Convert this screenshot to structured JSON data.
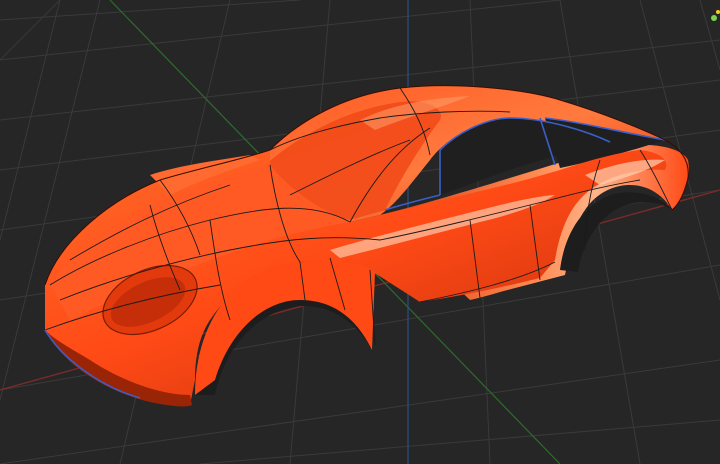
{
  "viewport": {
    "background_color": "#262626",
    "grid_color": "#3a3a3a",
    "axis_x_color": "#7a2a2a",
    "axis_y_color": "#2f6b2f",
    "axis_z_color": "#2b4f86"
  },
  "model": {
    "body_color": "#ff4a16",
    "highlight_color": "#ffb48a",
    "shadow_color": "#8a1f05",
    "isoparm_color": "#1a1a1a",
    "edge_selection_color": "#3a5fc8"
  },
  "indicator": {
    "icon": "status-dots-icon",
    "color_primary": "#7bd44a",
    "color_secondary": "#f2d023"
  }
}
